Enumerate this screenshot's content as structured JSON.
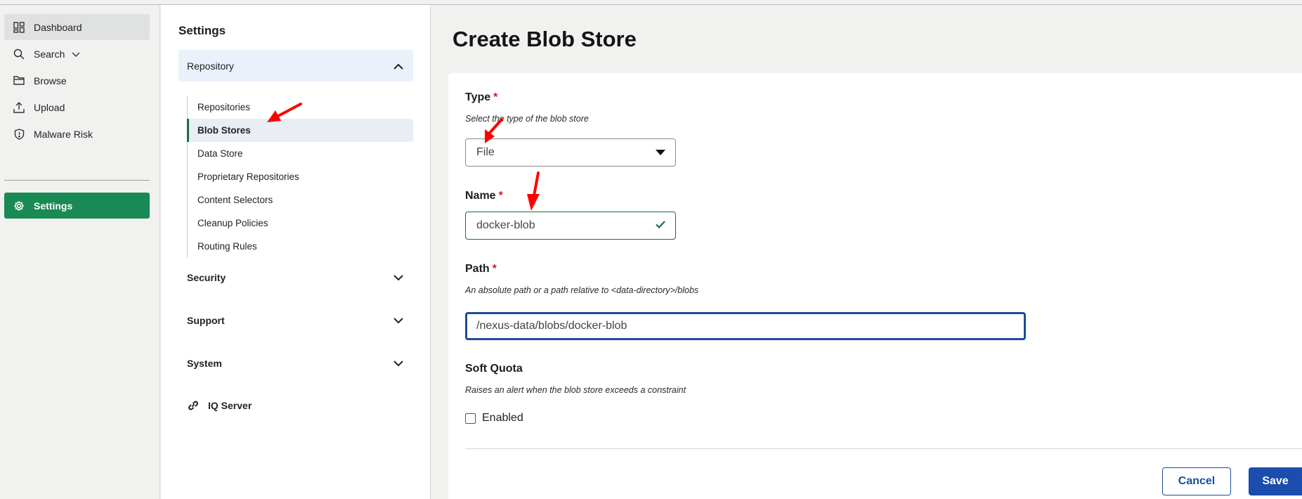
{
  "nav": {
    "items": [
      {
        "label": "Dashboard",
        "icon": "dashboard-icon"
      },
      {
        "label": "Search",
        "icon": "search-icon"
      },
      {
        "label": "Browse",
        "icon": "folder-icon"
      },
      {
        "label": "Upload",
        "icon": "upload-icon"
      },
      {
        "label": "Malware Risk",
        "icon": "shield-icon"
      },
      {
        "label": "Settings",
        "icon": "gear-icon"
      }
    ]
  },
  "settings": {
    "title": "Settings",
    "groups": {
      "repository": "Repository",
      "security": "Security",
      "support": "Support",
      "system": "System"
    },
    "repository_items": [
      "Repositories",
      "Blob Stores",
      "Data Store",
      "Proprietary Repositories",
      "Content Selectors",
      "Cleanup Policies",
      "Routing Rules"
    ],
    "iq_server": "IQ Server"
  },
  "page": {
    "title": "Create Blob Store"
  },
  "form": {
    "type": {
      "label": "Type",
      "required_mark": "*",
      "help": "Select the type of the blob store",
      "value": "File"
    },
    "name": {
      "label": "Name",
      "required_mark": "*",
      "value": "docker-blob"
    },
    "path": {
      "label": "Path",
      "required_mark": "*",
      "help": "An absolute path or a path relative to <data-directory>/blobs",
      "value": "/nexus-data/blobs/docker-blob"
    },
    "soft_quota": {
      "label": "Soft Quota",
      "help": "Raises an alert when the blob store exceeds a constraint",
      "checkbox_label": "Enabled",
      "checked": false
    },
    "buttons": {
      "cancel": "Cancel",
      "save": "Save"
    }
  },
  "colors": {
    "accent_green": "#1a8a54",
    "primary_blue": "#1a4dad",
    "required_red": "#c32020",
    "annotation_red": "#ff0000"
  }
}
